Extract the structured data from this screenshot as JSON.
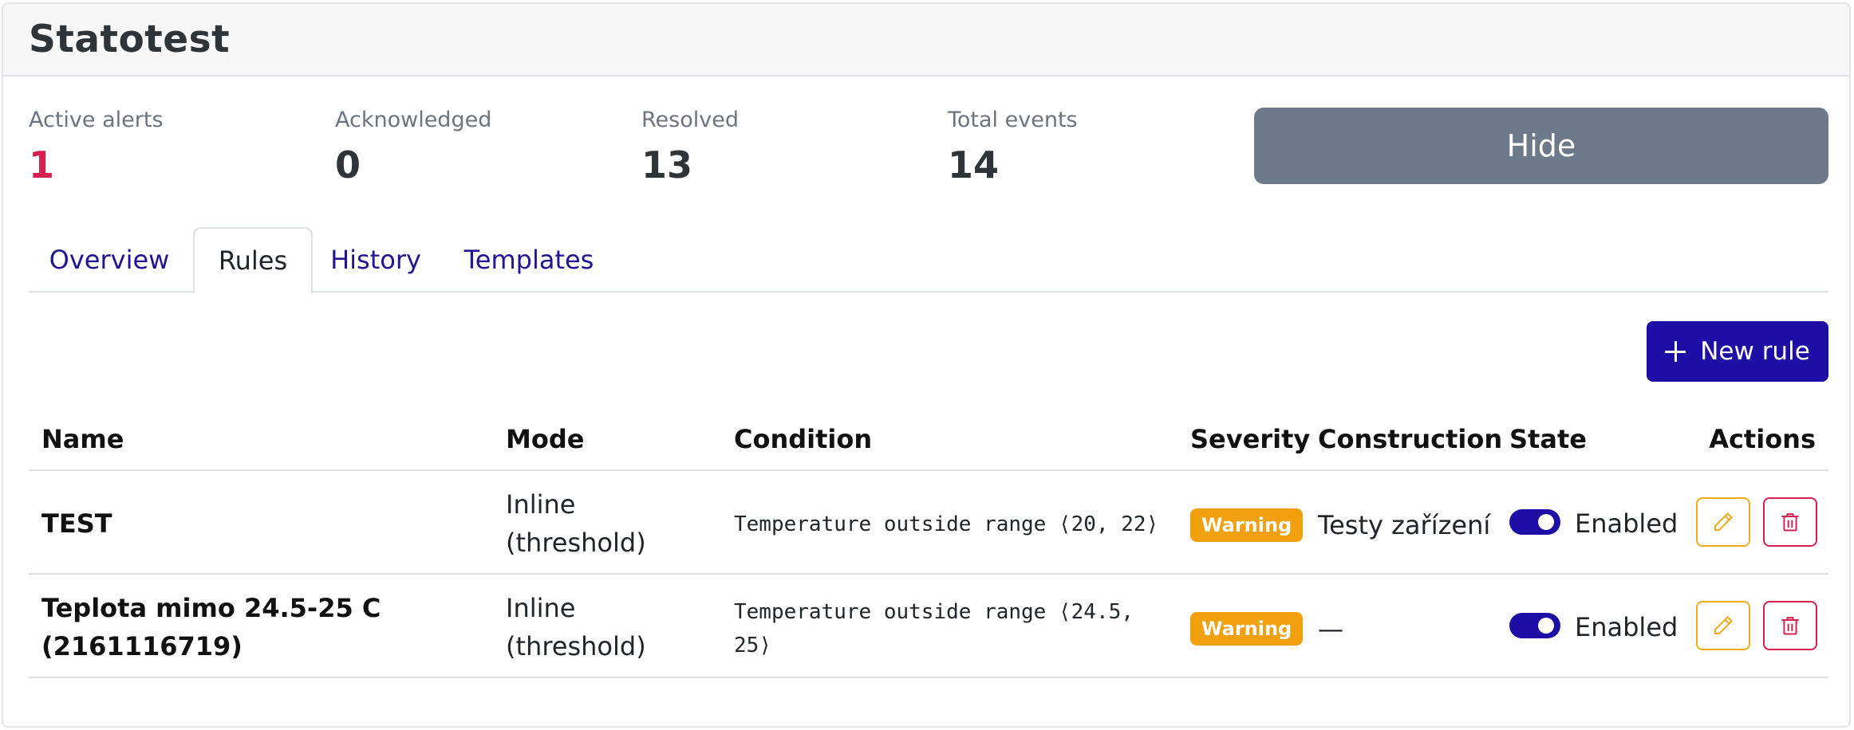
{
  "header": {
    "title": "Statotest"
  },
  "stats": [
    {
      "label": "Active alerts",
      "value": "1"
    },
    {
      "label": "Acknowledged",
      "value": "0"
    },
    {
      "label": "Resolved",
      "value": "13"
    },
    {
      "label": "Total events",
      "value": "14"
    }
  ],
  "hide_label": "Hide",
  "tabs": [
    {
      "label": "Overview"
    },
    {
      "label": "Rules"
    },
    {
      "label": "History"
    },
    {
      "label": "Templates"
    }
  ],
  "active_tab": "Rules",
  "new_rule_label": "New rule",
  "table": {
    "columns": [
      "Name",
      "Mode",
      "Condition",
      "Severity",
      "Construction",
      "State",
      "Actions"
    ],
    "rows": [
      {
        "name": "TEST",
        "mode": "Inline (threshold)",
        "condition": "Temperature outside range ⟨20, 22⟩",
        "severity": "Warning",
        "construction": "Testy zařízení",
        "state": "Enabled"
      },
      {
        "name": "Teplota mimo 24.5-25 C (2161116719)",
        "mode": "Inline (threshold)",
        "condition": "Temperature outside range ⟨24.5, 25⟩",
        "severity": "Warning",
        "construction": "—",
        "state": "Enabled"
      }
    ]
  },
  "colors": {
    "accent": "#1d0fa5",
    "alert": "#d6204f",
    "warning": "#f3a00f",
    "hide_button": "#6c7a89",
    "edit_border": "#f0ab1c",
    "delete_border": "#d6204f"
  },
  "icons": {
    "new_rule": "plus-icon",
    "edit": "pencil-icon",
    "delete": "trash-icon"
  }
}
